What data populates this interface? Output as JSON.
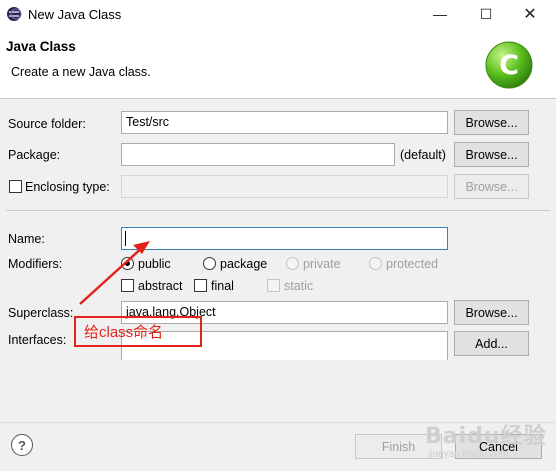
{
  "window": {
    "title": "New Java Class",
    "minimize_glyph": "—",
    "maximize_glyph": "☐",
    "close_glyph": "✕"
  },
  "banner": {
    "title": "Java Class",
    "description": "Create a new Java class.",
    "logo_letter": "C",
    "logo_color": "#4caf1c"
  },
  "source_folder": {
    "label": "Source folder:",
    "value": "Test/src",
    "browse_label": "Browse..."
  },
  "package": {
    "label": "Package:",
    "value": "",
    "default_label": "(default)",
    "browse_label": "Browse..."
  },
  "enclosing_type": {
    "label": "Enclosing type:",
    "checked": false,
    "value": "",
    "browse_label": "Browse..."
  },
  "name": {
    "label": "Name:",
    "value": ""
  },
  "modifiers": {
    "label": "Modifiers:",
    "public_label": "public",
    "package_label": "package",
    "private_label": "private",
    "protected_label": "protected",
    "selected": "public",
    "abstract_label": "abstract",
    "final_label": "final",
    "static_label": "static"
  },
  "superclass": {
    "label": "Superclass:",
    "value": "java.lang.Object",
    "browse_label": "Browse..."
  },
  "interfaces": {
    "label": "Interfaces:",
    "add_label": "Add..."
  },
  "footer": {
    "help_glyph": "?",
    "finish_label": "Finish",
    "cancel_label": "Cancel"
  },
  "annotation": {
    "text": "给class命名",
    "color": "#e2231a"
  },
  "watermark": {
    "text": "Baidu经验",
    "sub": "jingyan.baidu.com"
  }
}
